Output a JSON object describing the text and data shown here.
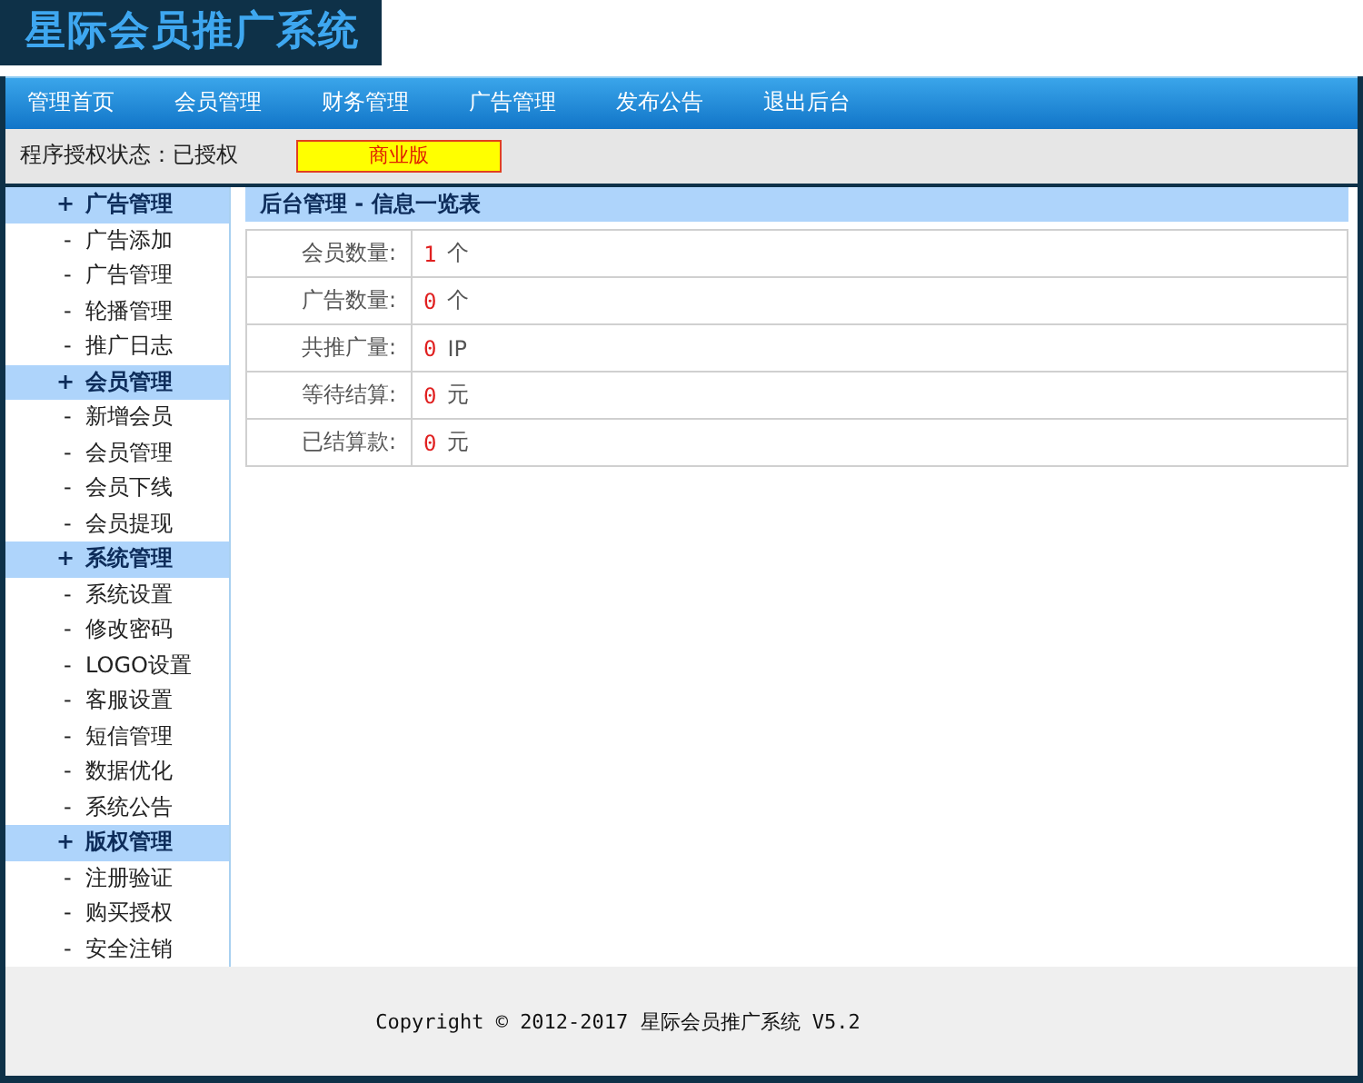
{
  "logo": {
    "title": "星际会员推广系统"
  },
  "nav": [
    {
      "label": "管理首页"
    },
    {
      "label": "会员管理"
    },
    {
      "label": "财务管理"
    },
    {
      "label": "广告管理"
    },
    {
      "label": "发布公告"
    },
    {
      "label": "退出后台"
    }
  ],
  "status": {
    "label": "程序授权状态：已授权",
    "badge": "商业版"
  },
  "sidebar": [
    {
      "marker": "+",
      "title": "广告管理",
      "items": [
        {
          "dash": "-",
          "label": "广告添加"
        },
        {
          "dash": "-",
          "label": "广告管理"
        },
        {
          "dash": "-",
          "label": "轮播管理"
        },
        {
          "dash": "-",
          "label": "推广日志"
        }
      ]
    },
    {
      "marker": "+",
      "title": "会员管理",
      "items": [
        {
          "dash": "-",
          "label": "新增会员"
        },
        {
          "dash": "-",
          "label": "会员管理"
        },
        {
          "dash": "-",
          "label": "会员下线"
        },
        {
          "dash": "-",
          "label": "会员提现"
        }
      ]
    },
    {
      "marker": "+",
      "title": "系统管理",
      "items": [
        {
          "dash": "-",
          "label": "系统设置"
        },
        {
          "dash": "-",
          "label": "修改密码"
        },
        {
          "dash": "-",
          "label": "LOGO设置"
        },
        {
          "dash": "-",
          "label": "客服设置"
        },
        {
          "dash": "-",
          "label": "短信管理"
        },
        {
          "dash": "-",
          "label": "数据优化"
        },
        {
          "dash": "-",
          "label": "系统公告"
        }
      ]
    },
    {
      "marker": "+",
      "title": "版权管理",
      "items": [
        {
          "dash": "-",
          "label": "注册验证"
        },
        {
          "dash": "-",
          "label": "购买授权"
        },
        {
          "dash": "-",
          "label": "安全注销"
        }
      ]
    }
  ],
  "panel": {
    "title": "后台管理 - 信息一览表",
    "rows": [
      {
        "label": "会员数量:",
        "value": "1",
        "unit": "个"
      },
      {
        "label": "广告数量:",
        "value": "0",
        "unit": "个"
      },
      {
        "label": "共推广量:",
        "value": "0",
        "unit": "IP"
      },
      {
        "label": "等待结算:",
        "value": "0",
        "unit": "元"
      },
      {
        "label": "已结算款:",
        "value": "0",
        "unit": "元"
      }
    ]
  },
  "footer": {
    "text": "Copyright © 2012-2017 星际会员推广系统 V5.2"
  }
}
